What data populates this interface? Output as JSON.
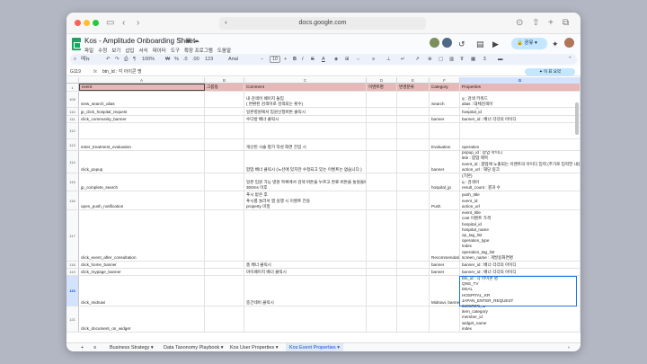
{
  "browser": {
    "url": "docs.google.com",
    "colors": {
      "red": "#ff5f57",
      "yellow": "#febc2e",
      "green": "#28c840"
    }
  },
  "doc": {
    "title": "Kos - Amplitude Onboarding Sheet",
    "menus": [
      "파일",
      "수정",
      "보기",
      "삽입",
      "서식",
      "데이터",
      "도구",
      "확장 프로그램",
      "도움말"
    ],
    "share_label": "공유",
    "brand_color": "#1ea362"
  },
  "toolbar": {
    "search": "메뉴",
    "zoom": "100%",
    "currency": "₩",
    "percent": "%",
    "dec1": ".0",
    "dec2": ".00",
    "num": "123",
    "font": "Arial",
    "font_size": "10"
  },
  "formula": {
    "cell": "G119",
    "value": "btn_id : 각 아이콘 명",
    "gemini_button": "이 표 요약"
  },
  "columns": [
    "",
    "A",
    "B",
    "C",
    "D",
    "E",
    "F",
    "G"
  ],
  "header_row": {
    "num": "1",
    "cells": [
      "event",
      "그룹핑",
      "Comment",
      "이벤트명",
      "변경분류",
      "Category",
      "Properties"
    ]
  },
  "rows": [
    {
      "num": "109",
      "a": "view_search_alias",
      "c": [
        "내 검색어 페이지 돌입",
        "( 변환된 검색어로 검색되는 횟수)"
      ],
      "f": "Search",
      "g": [
        "q : 검색 키워드",
        "alias : 대체검색어"
      ]
    },
    {
      "num": "110",
      "a": "jp_click_hospital_request",
      "c": [
        "일본병원에서 입원신청버튼 클릭시"
      ],
      "f": "",
      "g": [
        "hospital_name",
        "hospital_id"
      ]
    },
    {
      "num": "111",
      "a": "click_community_banner",
      "c": [
        "수다방 배너 클릭시"
      ],
      "f": "banner",
      "g": [
        "banner_id : 배너 각각의 아이디"
      ]
    },
    {
      "num": "112",
      "a": "",
      "c": [],
      "f": "",
      "g": []
    },
    {
      "num": "113",
      "a": "enter_treatment_evaluation",
      "c": [
        "개선된 시술 평가 작성 화면 진입 시"
      ],
      "f": "Evaluation",
      "g": [
        "operation"
      ]
    },
    {
      "num": "114",
      "a": "click_popup",
      "c": [
        "팝업 배너 클릭시 (노션에 있지만 수정되고 있는 이벤트는 없습니다.)"
      ],
      "f": "banner",
      "g": [
        "popup_id : 팝업 아이디",
        "title : 팝업 제목",
        "event_id : 팝업에 노출되는 이벤트의 아이디 입력 (추가로 입력한 내용",
        "action_url : 해당 링크"
      ]
    },
    {
      "num": "115",
      "a": "jp_complete_search",
      "c": [
        "일본 입원 가능 병원 목록에서 검색 버튼을 누르고 완료 버튼을 눌렀을때의 검색어",
        "300ms 이후"
      ],
      "f": "hospital_jp",
      "g": [
        "(기본)",
        "q : 검색어",
        "result_count : 결과 수"
      ]
    },
    {
      "num": "116",
      "a": "open_push_notification",
      "c": [
        "푸시 받은 후",
        "푸시를 눌러서 앱 실행 시 이벤트 전송",
        "property 미정"
      ],
      "f": "Push",
      "g": [
        "push_id",
        "push_title",
        "event_id",
        "action_url"
      ]
    },
    {
      "num": "117",
      "a": "click_event_after_consultation",
      "c": [],
      "f": "Recommendation",
      "g": [
        "event_id",
        "event_title",
        "cost 이벤트 가격",
        "hospital_id",
        "hospital_name",
        "op_tag_list",
        "operation_type",
        "index",
        "operation_tag_list",
        "screen_name : 개발용화면명"
      ]
    },
    {
      "num": "118",
      "a": "click_home_banner",
      "c": [
        "홈 배너 클릭시"
      ],
      "f": "banner",
      "g": [
        "banner_id : 배너 각각의 아이디"
      ]
    },
    {
      "num": "119",
      "a": "click_mypage_banner",
      "c": [
        "마이페이지 배너 클릭시"
      ],
      "f": "banner",
      "g": [
        "banner_id : 배너 각각의 아이디"
      ]
    },
    {
      "num": "119",
      "a": "click_midnavi",
      "c": [
        "중간네비 클릭시"
      ],
      "f": "Midnavi, banner",
      "g": [
        "btn_id : 각 아이콘 명",
        "QNS_TV",
        "DEAL",
        "HOSPITAL_KR",
        "JAPAN_ENTER_REQUEST",
        "DOCTOR"
      ]
    },
    {
      "num": "121",
      "a": "click_document_on_widget",
      "c": [],
      "f": "",
      "g": [
        "document_id",
        "item_category",
        "member_id",
        "widget_name",
        "index"
      ]
    }
  ],
  "tabs": [
    "Business Strategy",
    "Data Taxonomy Playbook",
    "Kos User Properties",
    "Kos Event Properties"
  ],
  "tab_colors": {
    "active_bg": "#e1e9f7",
    "active_text": "#0b57d0",
    "header_fill": "#e6b8b7",
    "selection": "#1a73e8"
  }
}
